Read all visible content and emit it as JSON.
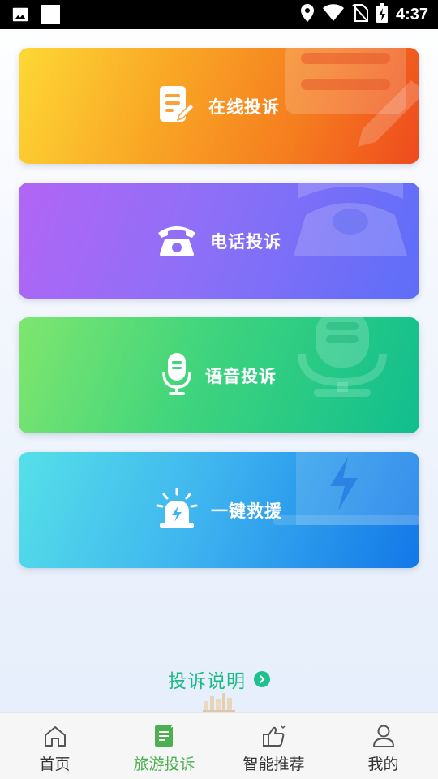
{
  "status_bar": {
    "time": "4:37",
    "icons": [
      "image-icon",
      "square-icon",
      "location-icon",
      "wifi-icon",
      "no-sim-icon",
      "battery-charging-icon"
    ]
  },
  "cards": [
    {
      "label": "在线投诉",
      "icon": "edit-document-icon"
    },
    {
      "label": "电话投诉",
      "icon": "telephone-icon"
    },
    {
      "label": "语音投诉",
      "icon": "microphone-icon"
    },
    {
      "label": "一键救援",
      "icon": "alarm-light-icon"
    }
  ],
  "explanation": {
    "label": "投诉说明",
    "icon": "chevron-right-icon"
  },
  "bottom_nav": {
    "items": [
      {
        "label": "首页",
        "icon": "home-icon",
        "active": false
      },
      {
        "label": "旅游投诉",
        "icon": "complaint-note-icon",
        "active": true
      },
      {
        "label": "智能推荐",
        "icon": "thumbs-up-icon",
        "active": false
      },
      {
        "label": "我的",
        "icon": "user-icon",
        "active": false
      }
    ]
  },
  "colors": {
    "accent_green": "#4caf50",
    "link_green": "#1db984",
    "card1": [
      "#fdd835",
      "#ee4a1e"
    ],
    "card2": [
      "#b265f5",
      "#5d6ef8"
    ],
    "card3": [
      "#7fe66e",
      "#10be8e"
    ],
    "card4": [
      "#55e0e8",
      "#1278e8"
    ]
  }
}
